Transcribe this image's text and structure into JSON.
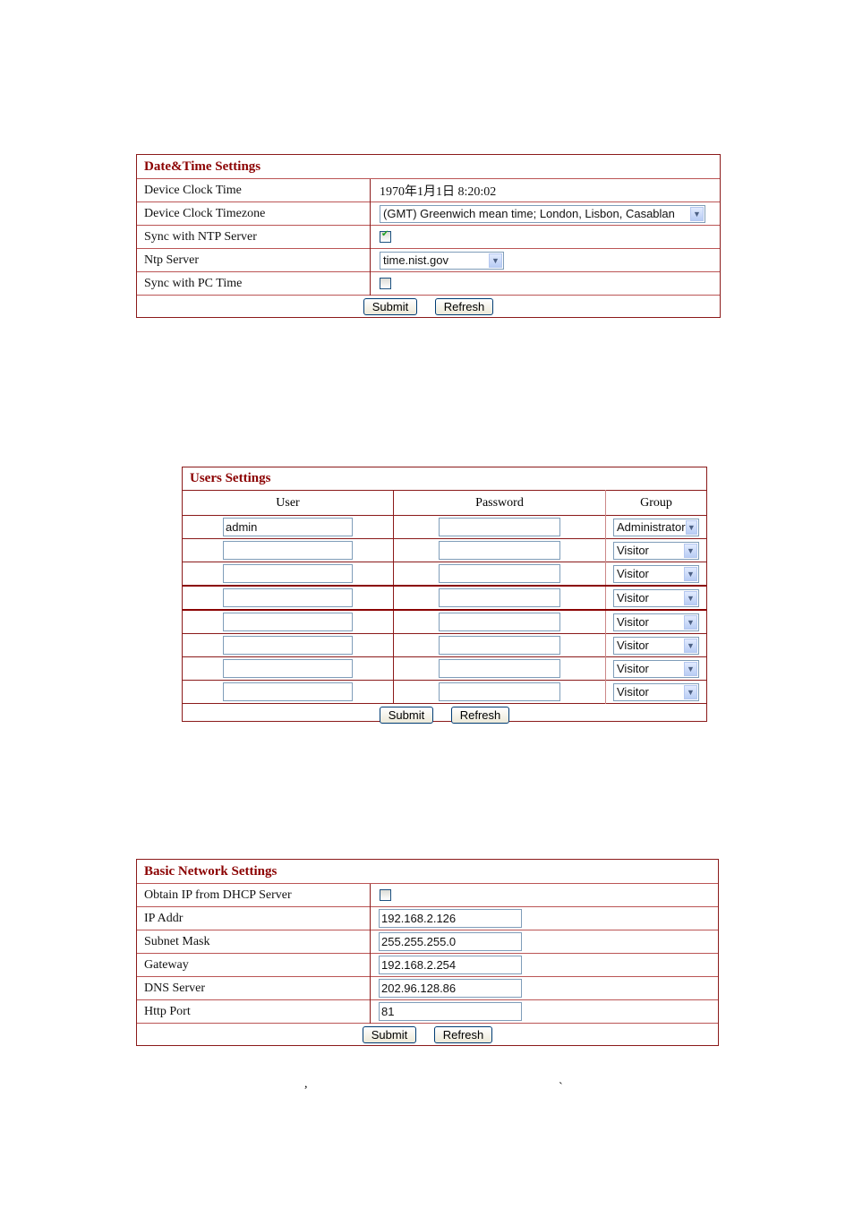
{
  "datetime": {
    "title": "Date&Time Settings",
    "rows": {
      "clock_time_label": "Device Clock Time",
      "clock_time_value": "1970年1月1日  8:20:02",
      "timezone_label": "Device Clock Timezone",
      "timezone_value": "(GMT) Greenwich mean time; London, Lisbon, Casablan",
      "ntp_sync_label": "Sync with NTP Server",
      "ntp_sync_checked": true,
      "ntp_server_label": "Ntp Server",
      "ntp_server_value": "time.nist.gov",
      "pc_sync_label": "Sync with PC Time",
      "pc_sync_checked": false
    },
    "submit_label": "Submit",
    "refresh_label": "Refresh"
  },
  "users": {
    "title": "Users Settings",
    "columns": [
      "User",
      "Password",
      "Group"
    ],
    "rows": [
      {
        "user": "admin",
        "password": "",
        "group": "Administrator"
      },
      {
        "user": "",
        "password": "",
        "group": "Visitor"
      },
      {
        "user": "",
        "password": "",
        "group": "Visitor"
      },
      {
        "user": "",
        "password": "",
        "group": "Visitor"
      },
      {
        "user": "",
        "password": "",
        "group": "Visitor"
      },
      {
        "user": "",
        "password": "",
        "group": "Visitor"
      },
      {
        "user": "",
        "password": "",
        "group": "Visitor"
      },
      {
        "user": "",
        "password": "",
        "group": "Visitor"
      }
    ],
    "submit_label": "Submit",
    "refresh_label": "Refresh"
  },
  "network": {
    "title": "Basic Network Settings",
    "dhcp_label": "Obtain IP from DHCP Server",
    "dhcp_checked": false,
    "ip_label": "IP Addr",
    "ip_value": "192.168.2.126",
    "mask_label": "Subnet Mask",
    "mask_value": "255.255.255.0",
    "gateway_label": "Gateway",
    "gateway_value": "192.168.2.254",
    "dns_label": "DNS Server",
    "dns_value": "202.96.128.86",
    "port_label": "Http Port",
    "port_value": "81",
    "submit_label": "Submit",
    "refresh_label": "Refresh"
  },
  "footer_marks": {
    "comma": ",",
    "accent": "`"
  }
}
